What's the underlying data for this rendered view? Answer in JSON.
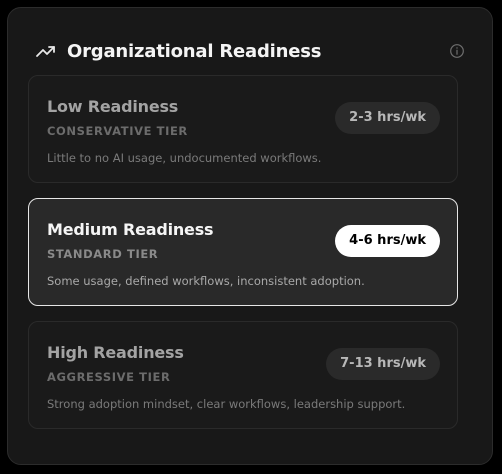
{
  "header": {
    "title": "Organizational Readiness",
    "icon": "trending-up-icon",
    "info_icon": "info-icon"
  },
  "tiers": [
    {
      "name": "Low Readiness",
      "subtitle": "CONSERVATIVE TIER",
      "description": "Little to no AI usage, undocumented workflows.",
      "hours": "2-3 hrs/wk",
      "selected": false
    },
    {
      "name": "Medium Readiness",
      "subtitle": "STANDARD TIER",
      "description": "Some usage, defined workflows, inconsistent adoption.",
      "hours": "4-6 hrs/wk",
      "selected": true
    },
    {
      "name": "High Readiness",
      "subtitle": "AGGRESSIVE TIER",
      "description": "Strong adoption mindset, clear workflows, leadership support.",
      "hours": "7-13 hrs/wk",
      "selected": false
    }
  ],
  "colors": {
    "background": "#000000",
    "panel": "#181818",
    "selected_border": "#e6e6e6",
    "selected_badge": "#ffffff"
  }
}
